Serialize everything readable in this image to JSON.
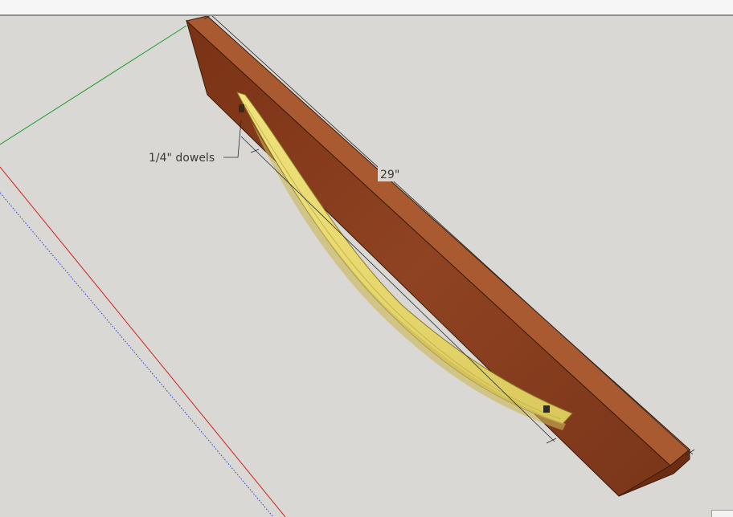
{
  "annotations": {
    "dowels_label": "1/4\" dowels",
    "length_label": "29\""
  },
  "colors": {
    "background": "#d9d8d4",
    "board": "#8a3e1c",
    "board_dark": "#6b2c12",
    "board_top": "#a95a30",
    "slat": "#e7da72",
    "slat_edge": "#b8a84a",
    "axis_red": "#d12020",
    "axis_green": "#1f9a2a",
    "axis_blue": "#2a3dcc"
  }
}
